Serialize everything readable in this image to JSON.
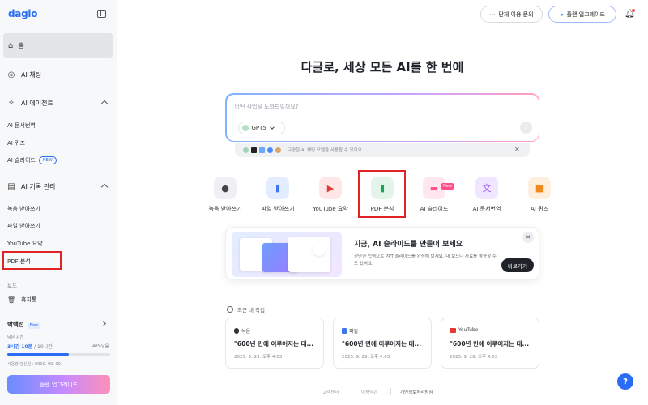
{
  "sidebar": {
    "logo": "daglo",
    "home": "홈",
    "ai_chat": "AI 채팅",
    "ai_agent": "AI 에이전트",
    "agent_items": [
      "AI 문서번역",
      "AI 퀴즈",
      "AI 슬라이드"
    ],
    "new_badge": "NEW",
    "record_mgmt": "AI 기록 관리",
    "record_items": [
      "녹음 받아쓰기",
      "파일 받아쓰기",
      "YouTube 요약",
      "PDF 분석"
    ],
    "board_label": "보드",
    "trash": "휴지통",
    "user_name": "박백선",
    "user_plan": "Free",
    "remain_label": "남은 시간",
    "remain_used": "3시간 10분",
    "remain_total": " / 10시간",
    "remain_pct_label": "40%남음",
    "remain_fraction": 0.6,
    "update_label": "사용량 갱신일 : 0000. 00. 00.",
    "upgrade_button": "플랜 업그레이드"
  },
  "topbar": {
    "team_button": "단체 이용 문의",
    "plan_button": "플랜 업그레이드"
  },
  "main": {
    "title": "다글로, 세상 모든 AI를 한 번에",
    "input_placeholder": "어떤 작업을 도와드릴까요?",
    "model": "GPT5",
    "strip_text": "다양한 AI 채팅 모델을 사용할 수 있어요",
    "tools": [
      {
        "label": "녹음 받아쓰기",
        "icon": "mic-icon"
      },
      {
        "label": "파일 받아쓰기",
        "icon": "file-icon"
      },
      {
        "label": "YouTube 요약",
        "icon": "youtube-icon"
      },
      {
        "label": "PDF 분석",
        "icon": "pdf-icon"
      },
      {
        "label": "AI 슬라이드",
        "icon": "slide-icon"
      },
      {
        "label": "AI 문서번역",
        "icon": "translate-icon"
      },
      {
        "label": "AI 퀴즈",
        "icon": "quiz-icon"
      }
    ],
    "tool_new_badge": "New",
    "promo_title": "지금, AI 슬라이드를 만들어 보세요",
    "promo_desc": "간단한 입력으로 PPT 슬라이드를 완성해 보세요. 내 보드나 자료를 활용할 수도 있어요.",
    "promo_button": "바로가기",
    "recent_label": "최근 내 작업",
    "recent": [
      {
        "type": "녹음",
        "title": "\"600년 만에 이루어지는 대...",
        "date": "2025. 9. 29. 오후 4:03"
      },
      {
        "type": "파일",
        "title": "\"600년 만에 이루어지는 대...",
        "date": "2025. 9. 29. 오후 4:03"
      },
      {
        "type": "YouTube",
        "title": "\"600년 만에 이루어지는 대...",
        "date": "2025. 9. 29. 오후 4:03"
      }
    ]
  },
  "footer": {
    "links": [
      "고객센터",
      "이용약관",
      "개인정보처리방침"
    ]
  },
  "help": "?",
  "colors": {
    "accent": "#2a6df4",
    "highlight": "#e02424"
  }
}
